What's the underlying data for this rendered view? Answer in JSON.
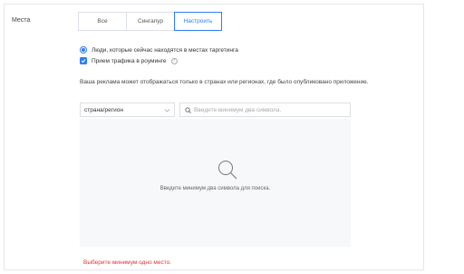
{
  "section": {
    "label": "Места"
  },
  "tabs": [
    {
      "label": "Все",
      "active": false
    },
    {
      "label": "Сингапур",
      "active": false
    },
    {
      "label": "Настроить",
      "active": true
    }
  ],
  "options": {
    "targeting_radio_label": "Люди, которые сейчас находятся в местах таргетинга",
    "targeting_radio_selected": true,
    "roaming_checkbox_label": "Прием трафика в роуминге",
    "roaming_checked": true,
    "help_icon": "question-mark"
  },
  "info_text": "Ваша реклама может отображаться только в странах или регионах, где было опубликовано приложение.",
  "region_select": {
    "value": "страна/регион"
  },
  "search": {
    "placeholder": "Введите минимум два символа.",
    "value": ""
  },
  "empty_state": {
    "icon": "search-icon",
    "text": "Введите минимум два символа для поиска."
  },
  "error_text": "Выберите минимум одно место.",
  "colors": {
    "accent": "#2f7df6",
    "error": "#d9363e",
    "panel_bg": "#f7f8fa",
    "border": "#dcdfe6"
  }
}
